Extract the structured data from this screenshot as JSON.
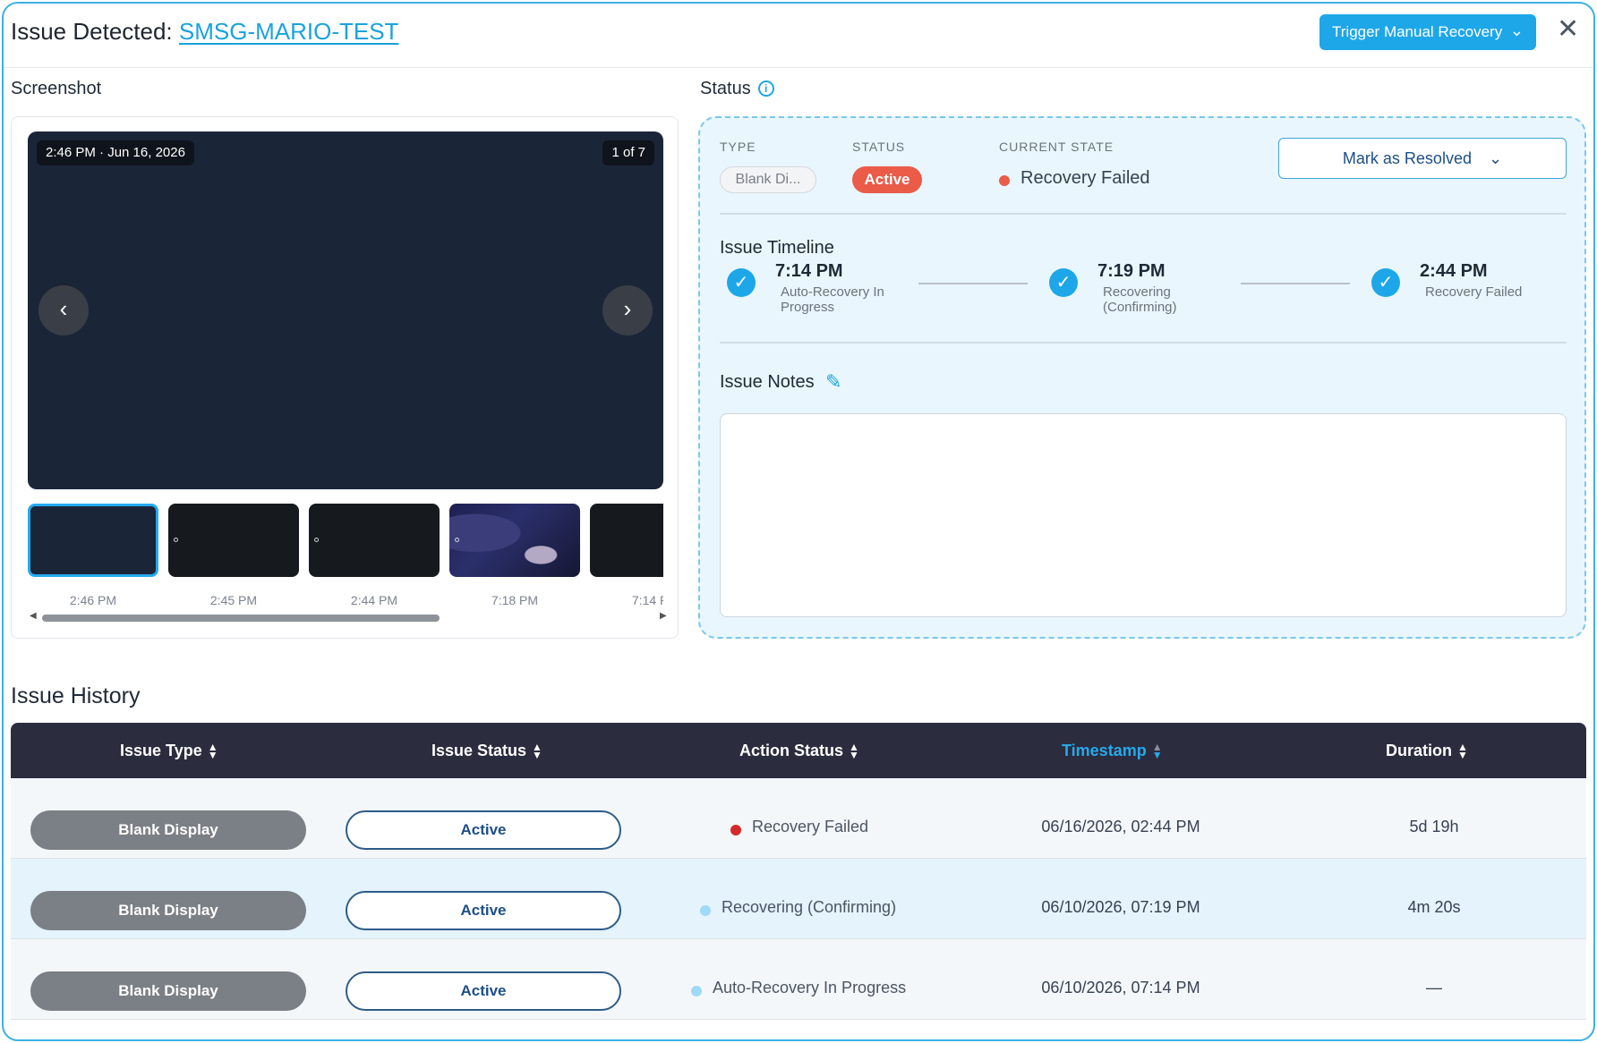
{
  "header": {
    "title_prefix": "Issue Detected:",
    "device_link": "SMSG-MARIO-TEST",
    "trigger_button": "Trigger Manual Recovery",
    "close": "✕"
  },
  "screenshot": {
    "label": "Screenshot",
    "timestamp_pill": "2:46 PM · Jun 16, 2026",
    "counter_pill": "1 of 7",
    "thumb_times": [
      "2:46 PM",
      "2:45 PM",
      "2:44 PM",
      "7:18 PM",
      "7:14 PM"
    ]
  },
  "status": {
    "label": "Status",
    "type_heading": "TYPE",
    "status_heading": "STATUS",
    "current_state_heading": "CURRENT STATE",
    "type_value": "Blank Di...",
    "status_value": "Active",
    "current_state_value": "Recovery Failed",
    "resolve_button": "Mark as Resolved",
    "timeline_title": "Issue Timeline",
    "timeline": [
      {
        "time": "7:14 PM",
        "desc": "Auto-Recovery In Progress"
      },
      {
        "time": "7:19 PM",
        "desc": "Recovering (Confirming)"
      },
      {
        "time": "2:44 PM",
        "desc": "Recovery Failed"
      }
    ],
    "notes_title": "Issue Notes",
    "notes_value": ""
  },
  "history": {
    "title": "Issue History",
    "columns": [
      "Issue Type",
      "Issue Status",
      "Action Status",
      "Timestamp",
      "Duration"
    ],
    "sorted_column": "Timestamp",
    "rows": [
      {
        "issue_type": "Blank Display",
        "issue_status": "Active",
        "action_status": "Recovery Failed",
        "action_color": "#d42a2a",
        "timestamp": "06/16/2026, 02:44 PM",
        "duration": "5d 19h"
      },
      {
        "issue_type": "Blank Display",
        "issue_status": "Active",
        "action_status": "Recovering (Confirming)",
        "action_color": "#9fd9f5",
        "timestamp": "06/10/2026, 07:19 PM",
        "duration": "4m 20s"
      },
      {
        "issue_type": "Blank Display",
        "issue_status": "Active",
        "action_status": "Auto-Recovery In Progress",
        "action_color": "#9fd9f5",
        "timestamp": "06/10/2026, 07:14 PM",
        "duration": "—"
      }
    ]
  },
  "colors": {
    "accent": "#1ea7e8",
    "active_red": "#ea5b48",
    "table_header": "#2b2c3e"
  }
}
